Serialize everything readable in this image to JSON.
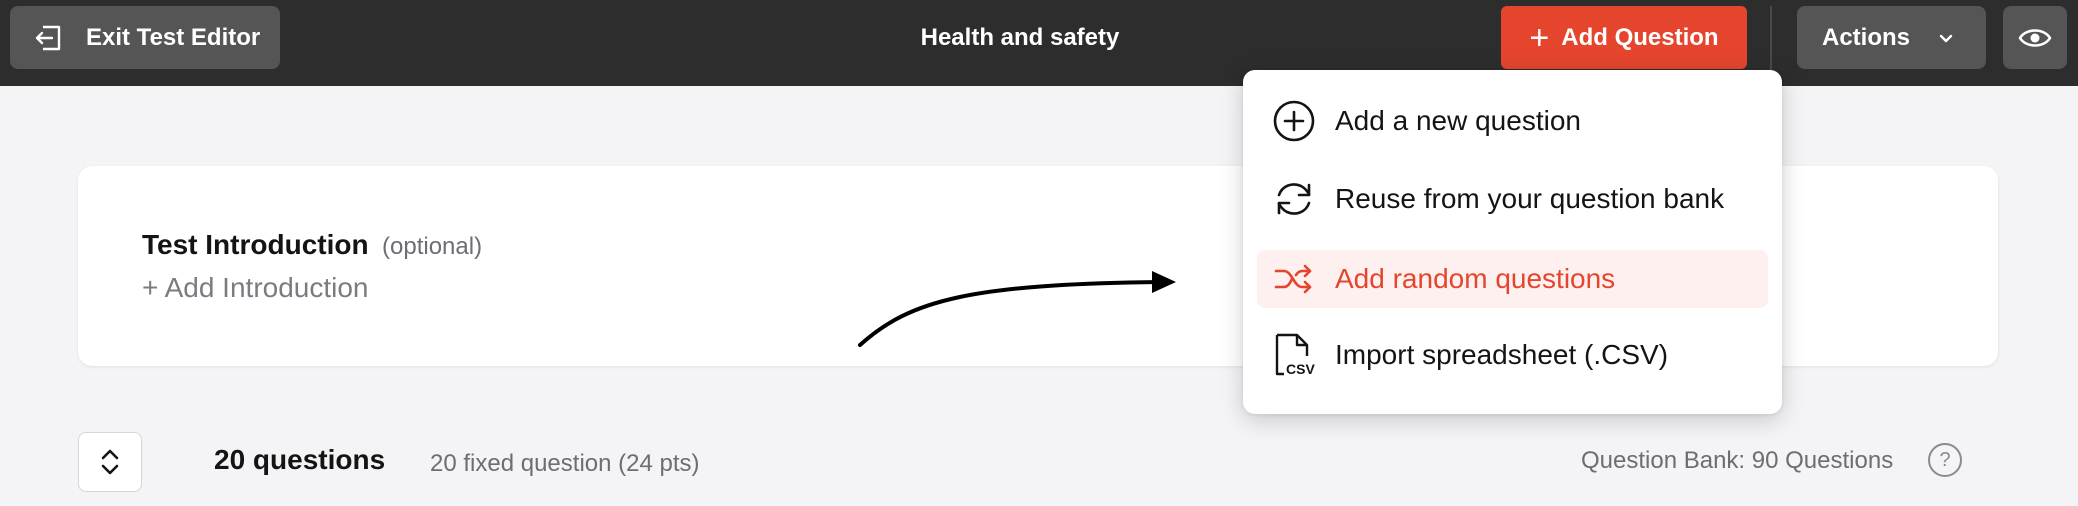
{
  "header": {
    "exit_label": "Exit Test Editor",
    "title": "Health and safety",
    "add_question_label": "Add Question",
    "actions_label": "Actions",
    "accent_color": "#e5452d"
  },
  "dropdown": {
    "items": [
      {
        "label": "Add a new question",
        "icon": "plus-circle-icon"
      },
      {
        "label": "Reuse from your question bank",
        "icon": "refresh-icon"
      },
      {
        "label": "Add random questions",
        "icon": "shuffle-icon",
        "active": true
      },
      {
        "label": "Import spreadsheet (.CSV)",
        "icon": "csv-file-icon"
      }
    ]
  },
  "intro": {
    "title": "Test Introduction",
    "optional": "(optional)",
    "add_label": "+ Add Introduction"
  },
  "questions": {
    "count_label": "20 questions",
    "fixed_label": "20 fixed question (24 pts)",
    "bank_label": "Question Bank: 90 Questions",
    "help": "?"
  }
}
